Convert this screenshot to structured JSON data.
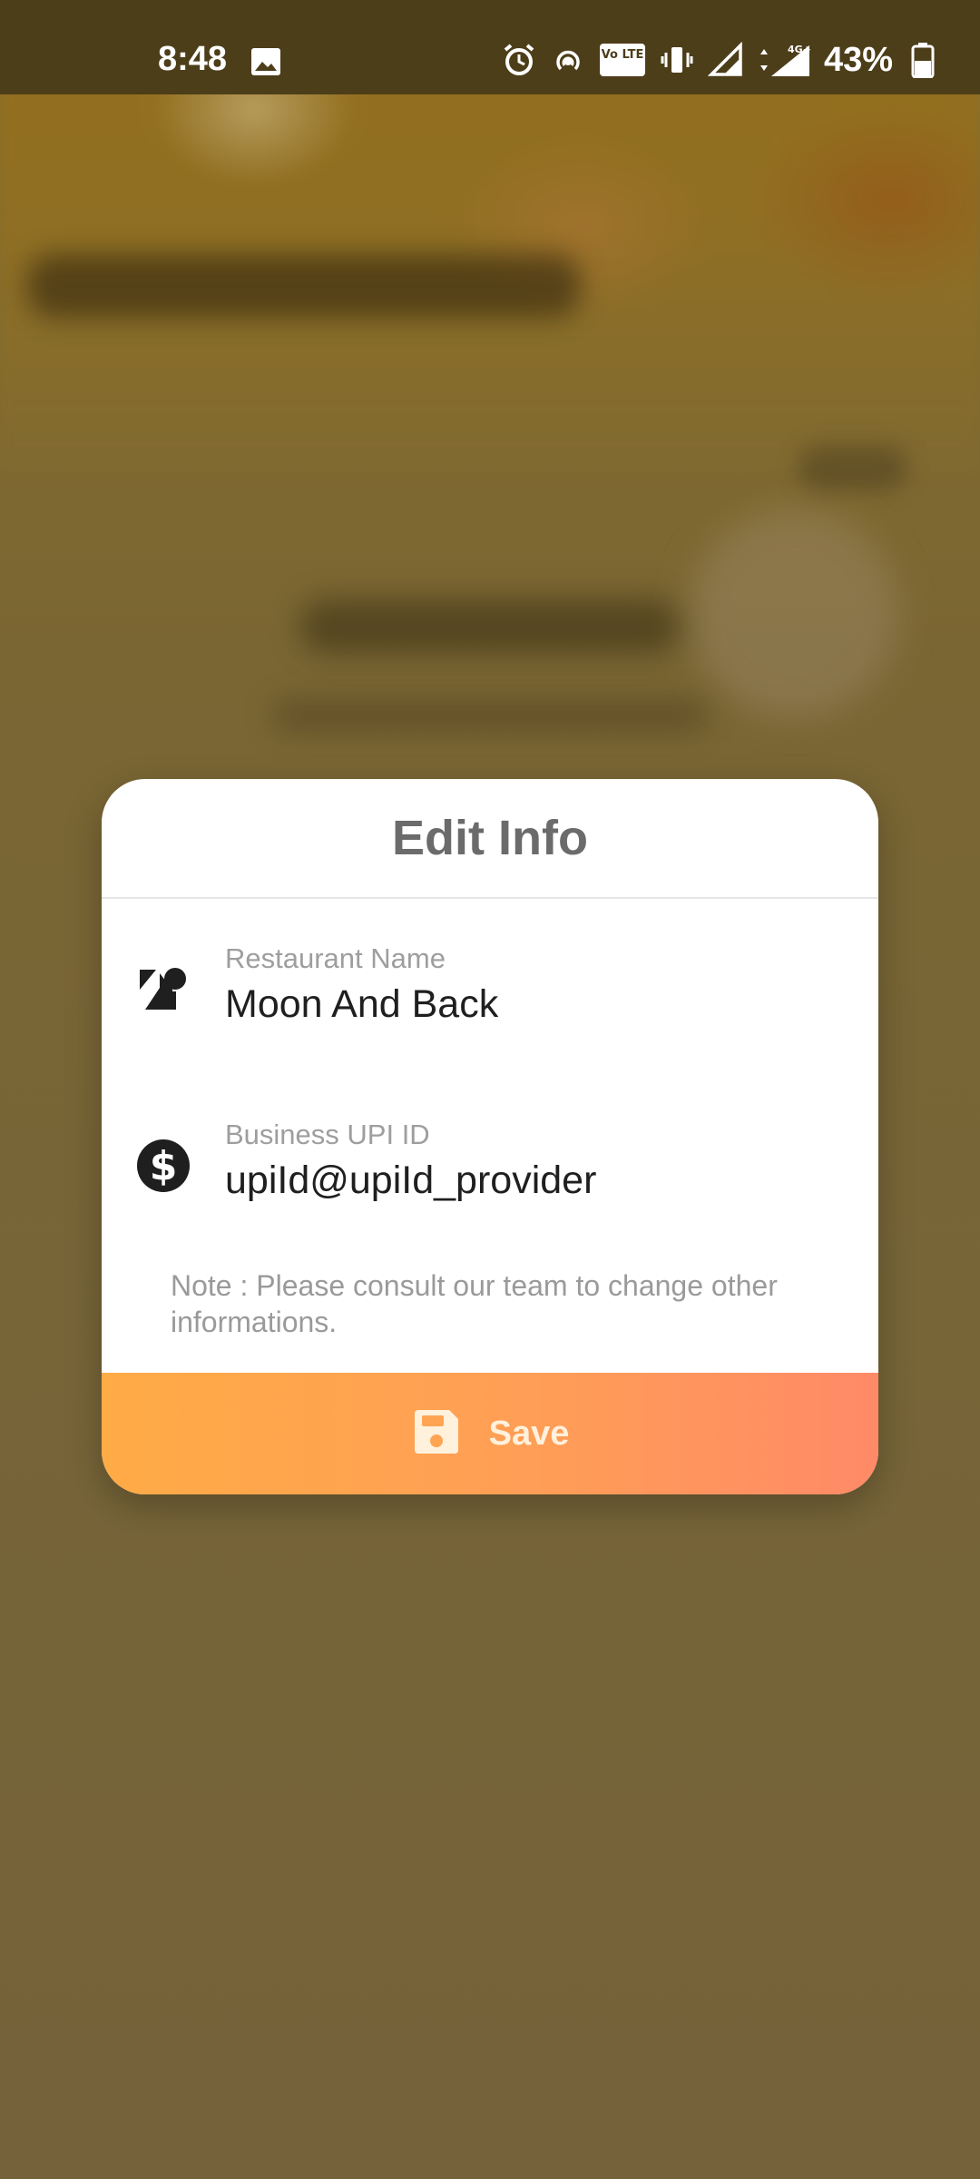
{
  "status_bar": {
    "time": "8:48",
    "battery_percent": "43%",
    "icons": [
      "image-icon",
      "alarm-icon",
      "hotspot-icon",
      "volte-icon",
      "vibrate-icon",
      "signal-icon",
      "signal-4g-icon",
      "battery-icon"
    ],
    "volte_text": "Vo LTE",
    "network_label": "4G+"
  },
  "dialog": {
    "title": "Edit Info",
    "fields": [
      {
        "label": "Restaurant Name",
        "value": "Moon And Back",
        "icon": "category-icon"
      },
      {
        "label": "Business UPI ID",
        "value": "upiId@upiId_provider",
        "icon": "dollar-circle-icon"
      }
    ],
    "note": "Note : Please consult our team to change other informations.",
    "save_label": "Save",
    "save_icon": "floppy-disk-icon"
  },
  "colors": {
    "accent_start": "#ffab46",
    "accent_end": "#ff8a67",
    "title_text": "#6b6b6b",
    "scrim": "#76633a"
  }
}
